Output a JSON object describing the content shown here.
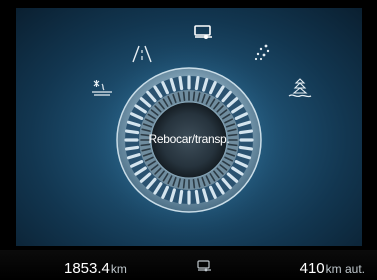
{
  "drive_mode": {
    "label": "Rebocar/transp.",
    "selected_icon": "trailer-tow-icon"
  },
  "mode_icons": [
    "trailer-tow-icon",
    "slippery-road-icon",
    "sand-icon",
    "snow-icon",
    "mud-ruts-icon"
  ],
  "odometer": {
    "value": "1853.4",
    "unit": "km"
  },
  "range": {
    "value": "410",
    "unit": "km aut."
  },
  "bottom_icon": "trailer-tow-icon",
  "colors": {
    "background": "#000000",
    "panel_center": "#2e6f95",
    "panel_edge": "#0a1f30",
    "dial_ring": "#a8c6d8",
    "text": "#ffffff"
  }
}
